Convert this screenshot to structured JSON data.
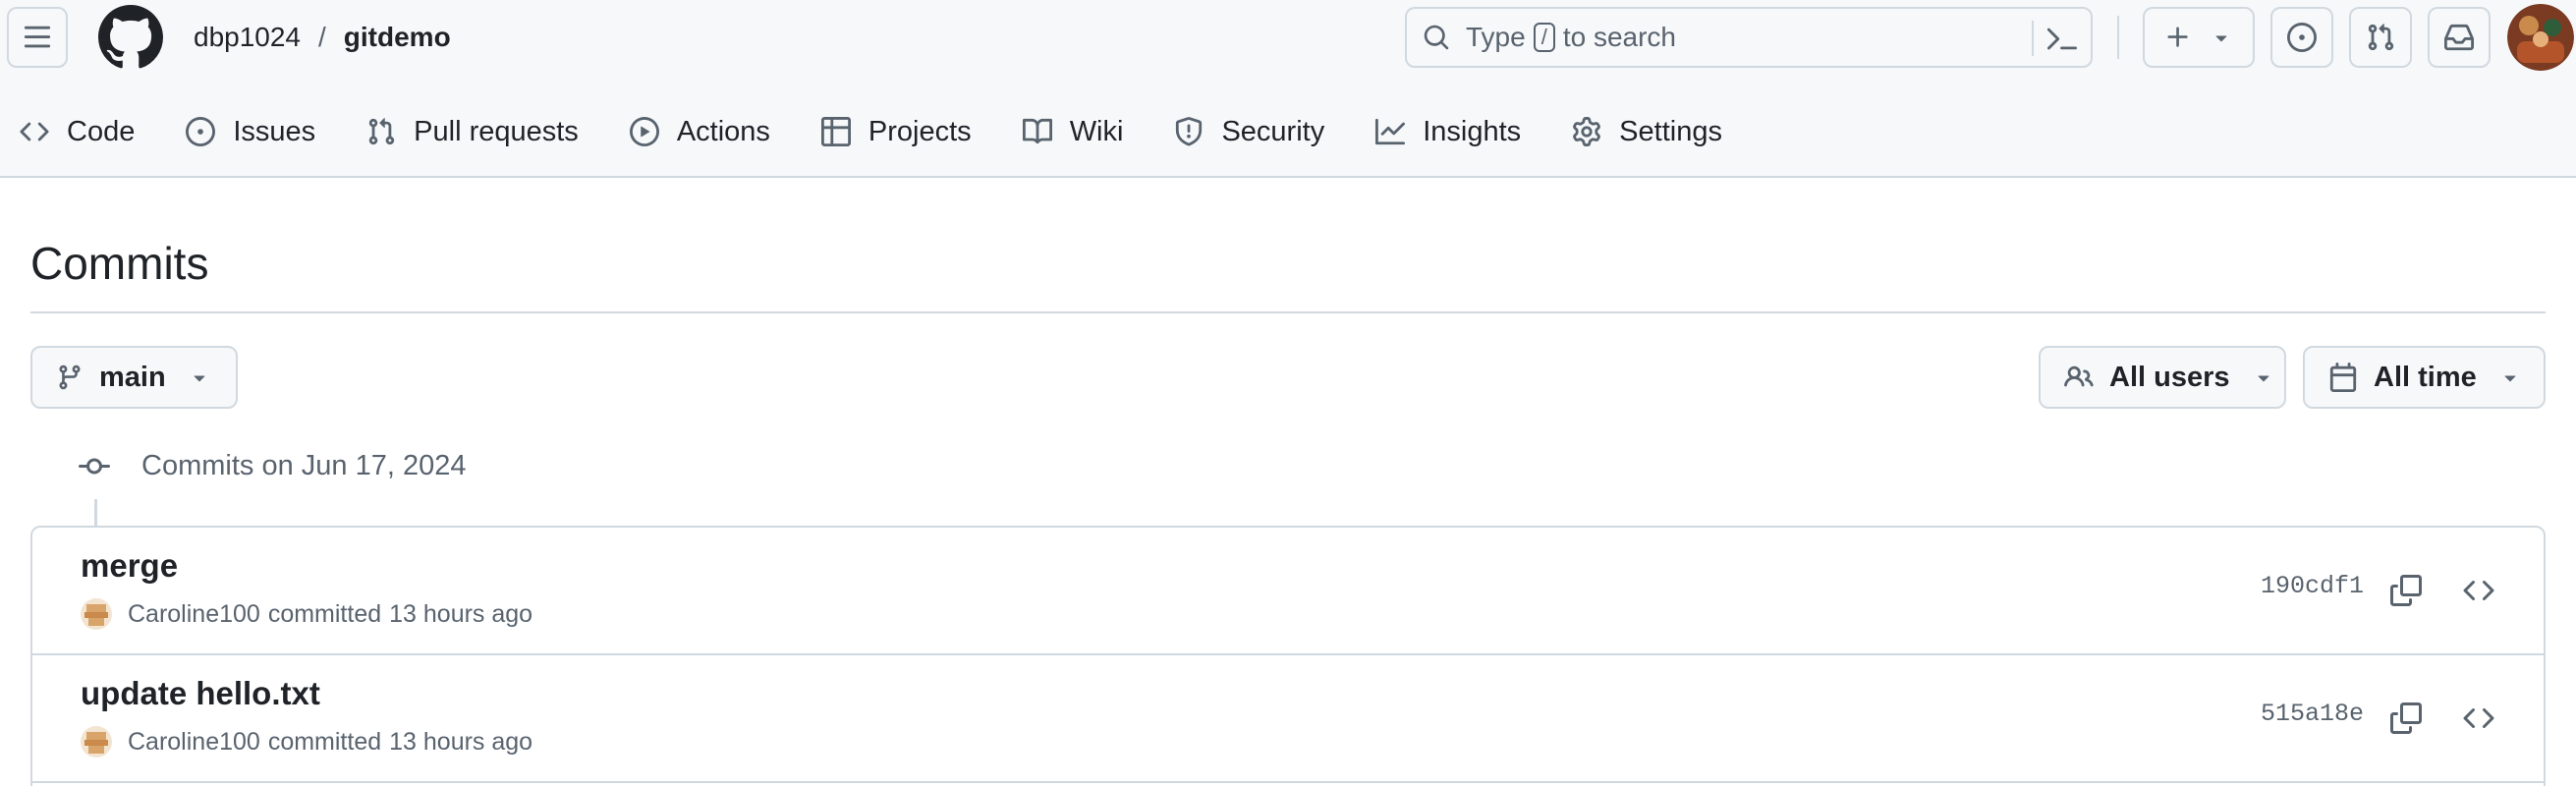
{
  "header": {
    "owner": "dbp1024",
    "separator": "/",
    "repo": "gitdemo",
    "search": {
      "prefix": "Type",
      "key": "/",
      "suffix": "to search"
    }
  },
  "repo_nav": [
    {
      "label": "Code",
      "icon": "code-icon"
    },
    {
      "label": "Issues",
      "icon": "issue-opened-icon"
    },
    {
      "label": "Pull requests",
      "icon": "git-pull-request-icon"
    },
    {
      "label": "Actions",
      "icon": "play-icon"
    },
    {
      "label": "Projects",
      "icon": "table-icon"
    },
    {
      "label": "Wiki",
      "icon": "book-icon"
    },
    {
      "label": "Security",
      "icon": "shield-icon"
    },
    {
      "label": "Insights",
      "icon": "graph-icon"
    },
    {
      "label": "Settings",
      "icon": "gear-icon"
    }
  ],
  "page": {
    "title": "Commits",
    "branch": "main",
    "users_filter": "All users",
    "time_filter": "All time"
  },
  "commit_group": {
    "label": "Commits on Jun 17, 2024",
    "commits": [
      {
        "title": "merge",
        "author": "Caroline100",
        "verb": "committed",
        "time": "13 hours ago",
        "sha": "190cdf1"
      },
      {
        "title": "update hello.txt",
        "author": "Caroline100",
        "verb": "committed",
        "time": "13 hours ago",
        "sha": "515a18e"
      }
    ]
  },
  "colors": {
    "header_bg": "#f6f8fa",
    "border": "#d1d9e0",
    "text": "#1f2328",
    "muted": "#59636e"
  }
}
